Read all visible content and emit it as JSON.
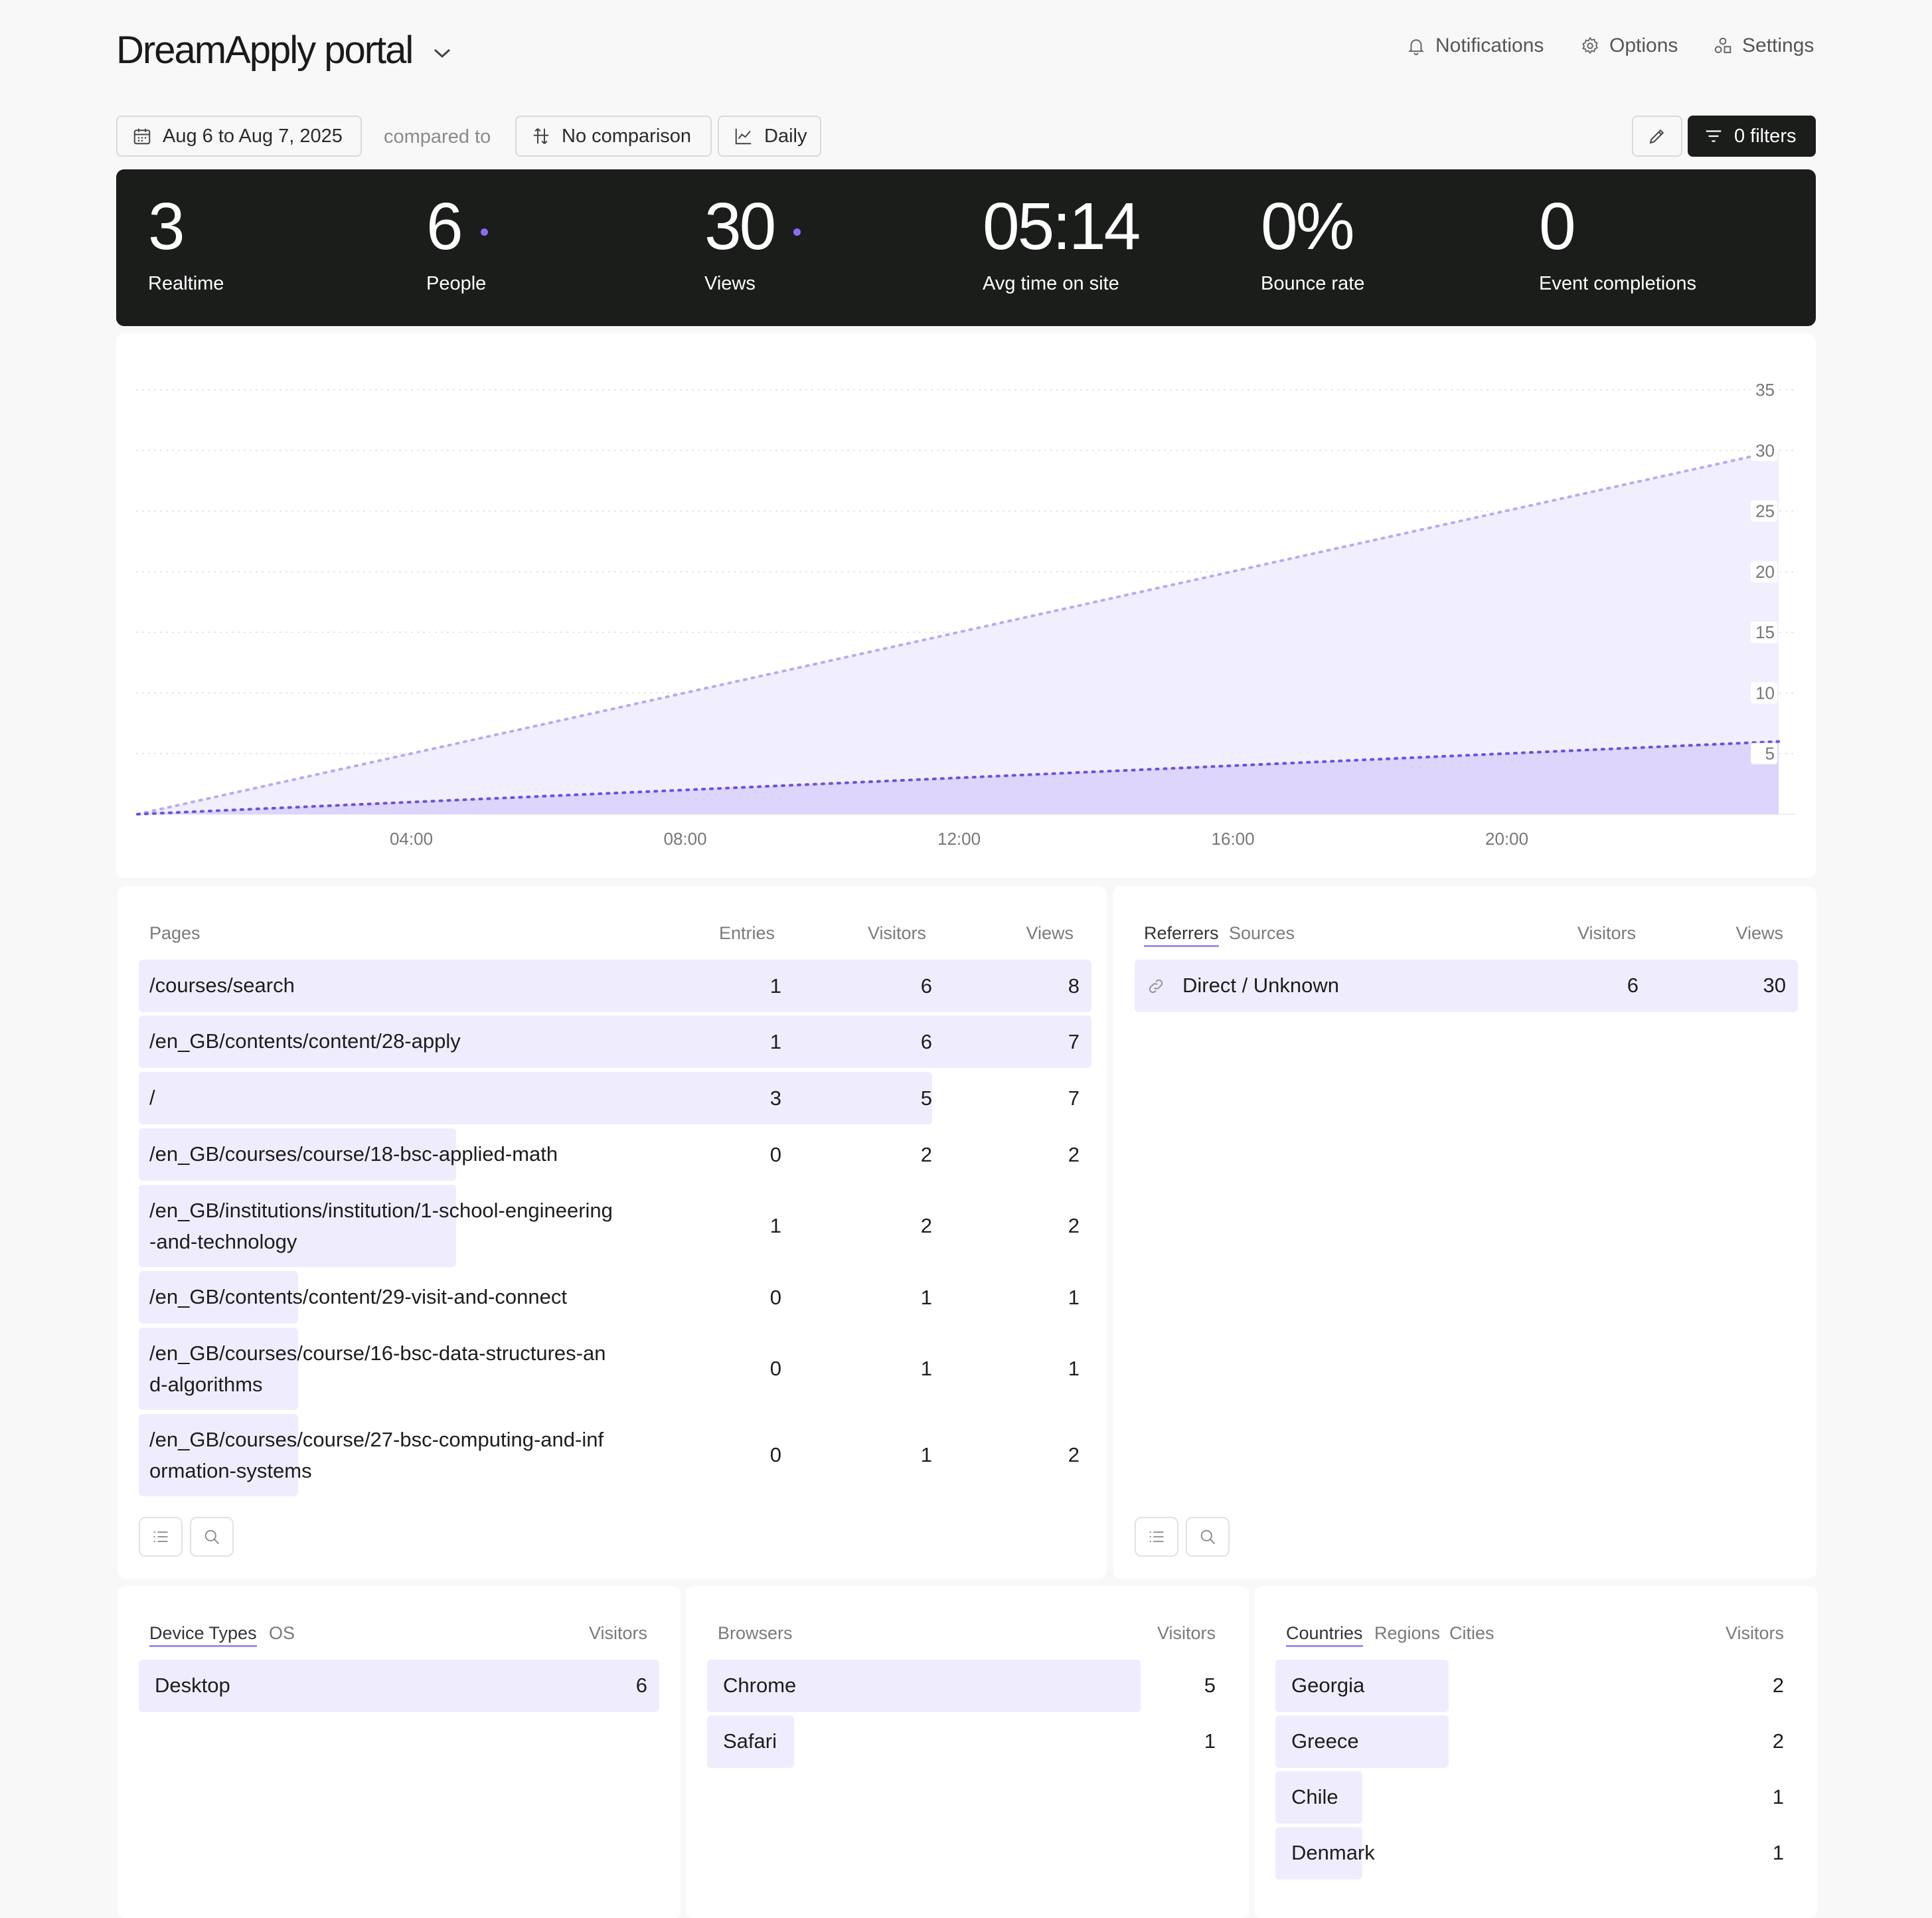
{
  "header": {
    "title": "DreamApply portal",
    "links": [
      {
        "label": "Notifications",
        "icon": "bell-icon"
      },
      {
        "label": "Options",
        "icon": "gear-icon"
      },
      {
        "label": "Settings",
        "icon": "shapes-icon"
      }
    ]
  },
  "toolbar": {
    "date_range": "Aug 6 to Aug 7, 2025",
    "compared_to": "compared to",
    "comparison": "No comparison",
    "interval": "Daily",
    "filters": "0 filters"
  },
  "stats": [
    {
      "value": "3",
      "label": "Realtime"
    },
    {
      "value": "6",
      "label": "People"
    },
    {
      "value": "30",
      "label": "Views"
    },
    {
      "value": "05:14",
      "label": "Avg time on site"
    },
    {
      "value": "0%",
      "label": "Bounce rate"
    },
    {
      "value": "0",
      "label": "Event completions"
    }
  ],
  "chart_data": {
    "type": "area",
    "x": [
      "00:00",
      "23:00"
    ],
    "x_tick_labels": [
      "04:00",
      "08:00",
      "12:00",
      "16:00",
      "20:00"
    ],
    "y_ticks": [
      5,
      10,
      15,
      20,
      25,
      30,
      35
    ],
    "ylim": [
      0,
      35
    ],
    "series": [
      {
        "values": [
          0,
          30
        ],
        "color": "#b9a9f5"
      },
      {
        "values": [
          0,
          6
        ],
        "color": "#6d4fe0"
      }
    ],
    "grid": true
  },
  "pages": {
    "headers": {
      "name": "Pages",
      "entries": "Entries",
      "visitors": "Visitors",
      "views": "Views"
    },
    "rows": [
      {
        "line1": "/courses/search",
        "line2": "",
        "entries": "1",
        "visitors": "6",
        "views": "8",
        "share": 1.0
      },
      {
        "line1": "/en_GB/contents/content/28-apply",
        "line2": "",
        "entries": "1",
        "visitors": "6",
        "views": "7",
        "share": 1.0
      },
      {
        "line1": "/",
        "line2": "",
        "entries": "3",
        "visitors": "5",
        "views": "7",
        "share": 0.833
      },
      {
        "line1": "/en_GB/courses/course/18-bsc-applied-math",
        "line2": "",
        "entries": "0",
        "visitors": "2",
        "views": "2",
        "share": 0.333
      },
      {
        "line1": "/en_GB/institutions/institution/1-school-engineering",
        "line2": "-and-technology",
        "entries": "1",
        "visitors": "2",
        "views": "2",
        "share": 0.333
      },
      {
        "line1": "/en_GB/contents/content/29-visit-and-connect",
        "line2": "",
        "entries": "0",
        "visitors": "1",
        "views": "1",
        "share": 0.167
      },
      {
        "line1": "/en_GB/courses/course/16-bsc-data-structures-an",
        "line2": "d-algorithms",
        "entries": "0",
        "visitors": "1",
        "views": "1",
        "share": 0.167
      },
      {
        "line1": "/en_GB/courses/course/27-bsc-computing-and-inf",
        "line2": "ormation-systems",
        "entries": "0",
        "visitors": "1",
        "views": "2",
        "share": 0.167
      }
    ]
  },
  "referrers": {
    "tabs": [
      "Referrers",
      "Sources"
    ],
    "headers": {
      "visitors": "Visitors",
      "views": "Views"
    },
    "rows": [
      {
        "name": "Direct / Unknown",
        "visitors": "6",
        "views": "30",
        "share": 1.0
      }
    ]
  },
  "devices": {
    "tabs": [
      "Device Types",
      "OS"
    ],
    "header": "Visitors",
    "rows": [
      {
        "name": "Desktop",
        "visitors": "6",
        "share": 1.0
      }
    ]
  },
  "browsers": {
    "title": "Browsers",
    "header": "Visitors",
    "rows": [
      {
        "name": "Chrome",
        "visitors": "5",
        "share": 0.833
      },
      {
        "name": "Safari",
        "visitors": "1",
        "share": 0.167
      }
    ]
  },
  "countries": {
    "tabs": [
      "Countries",
      "Regions",
      "Cities"
    ],
    "header": "Visitors",
    "rows": [
      {
        "name": "Georgia",
        "visitors": "2",
        "share": 0.333
      },
      {
        "name": "Greece",
        "visitors": "2",
        "share": 0.333
      },
      {
        "name": "Chile",
        "visitors": "1",
        "share": 0.167
      },
      {
        "name": "Denmark",
        "visitors": "1",
        "share": 0.167
      }
    ]
  }
}
